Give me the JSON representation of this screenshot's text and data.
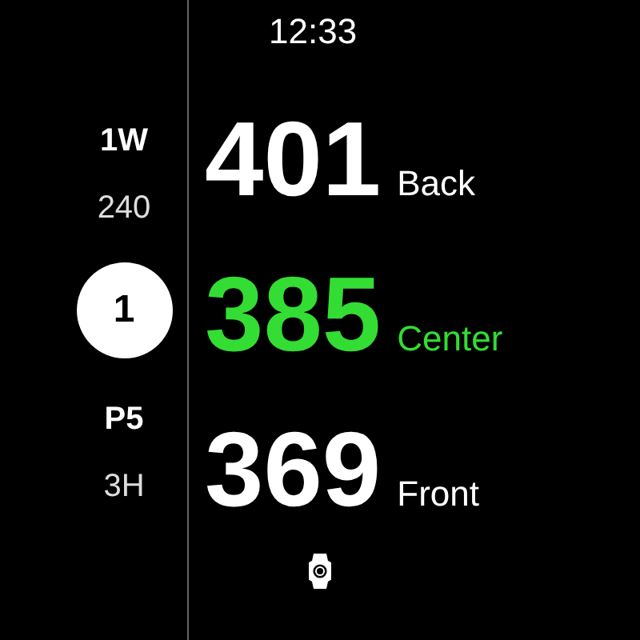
{
  "time": "12:33",
  "upper": {
    "label": "1W",
    "value": "240"
  },
  "hole_number": "1",
  "lower": {
    "label": "P5",
    "value": "3H"
  },
  "distances": [
    {
      "value": "401",
      "label": "Back",
      "color": "#ffffff"
    },
    {
      "value": "385",
      "label": "Center",
      "color": "#33dd33"
    },
    {
      "value": "369",
      "label": "Front",
      "color": "#ffffff"
    }
  ]
}
